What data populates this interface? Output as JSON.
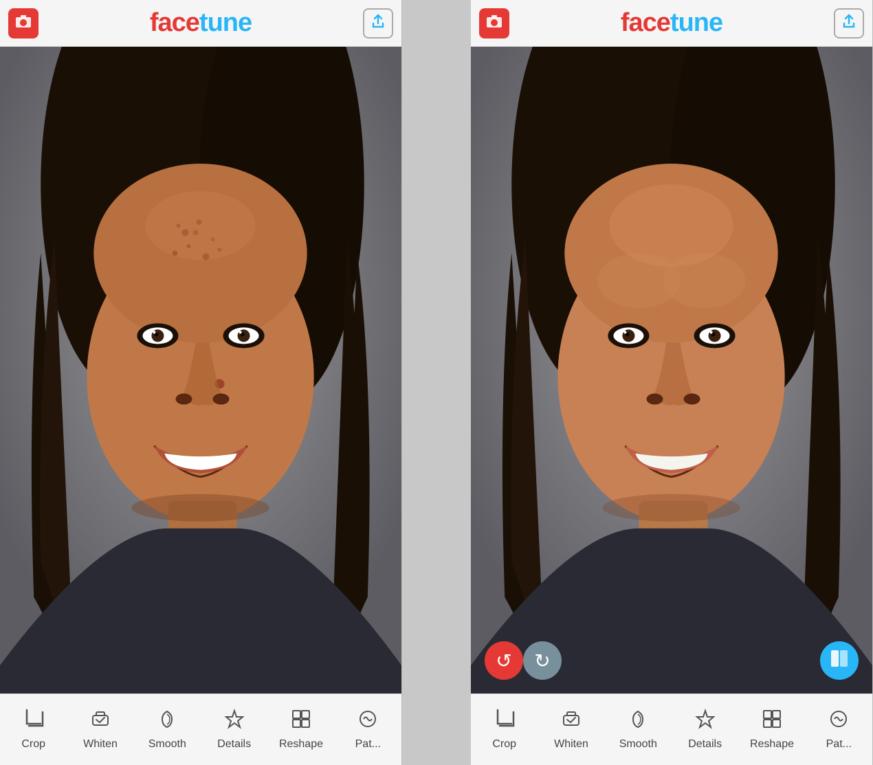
{
  "panels": [
    {
      "id": "before",
      "header": {
        "camera_label": "📷",
        "title_face": "face",
        "title_tune": "tune",
        "share_label": "↑"
      },
      "show_action_buttons": false,
      "toolbar": {
        "items": [
          {
            "icon": "crop",
            "label": "Crop"
          },
          {
            "icon": "whiten",
            "label": "Whiten"
          },
          {
            "icon": "smooth",
            "label": "Smooth"
          },
          {
            "icon": "details",
            "label": "Details"
          },
          {
            "icon": "reshape",
            "label": "Reshape"
          },
          {
            "icon": "patch",
            "label": "Pat..."
          }
        ]
      }
    },
    {
      "id": "after",
      "header": {
        "camera_label": "📷",
        "title_face": "face",
        "title_tune": "tune",
        "share_label": "↑"
      },
      "show_action_buttons": true,
      "action_buttons": {
        "undo_label": "↺",
        "redo_label": "↻",
        "compare_label": "⧉"
      },
      "toolbar": {
        "items": [
          {
            "icon": "crop",
            "label": "Crop"
          },
          {
            "icon": "whiten",
            "label": "Whiten"
          },
          {
            "icon": "smooth",
            "label": "Smooth"
          },
          {
            "icon": "details",
            "label": "Details"
          },
          {
            "icon": "reshape",
            "label": "Reshape"
          },
          {
            "icon": "patch",
            "label": "Pat..."
          }
        ]
      }
    }
  ],
  "colors": {
    "red": "#e53935",
    "cyan": "#29b6f6",
    "gray_bg": "#f5f5f5",
    "toolbar_text": "#444",
    "undo_color": "#e53935",
    "redo_color": "#78909c",
    "compare_color": "#29b6f6"
  }
}
